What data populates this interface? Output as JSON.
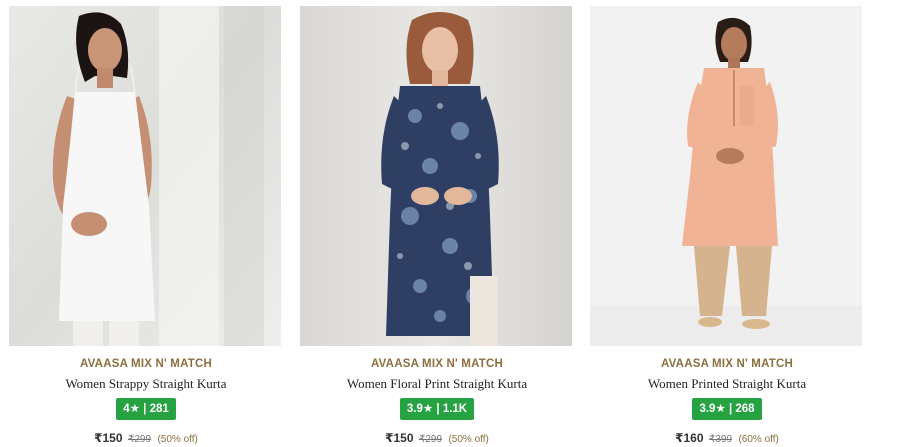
{
  "products": [
    {
      "brand": "AVAASA MIX N' MATCH",
      "name": "Women Strappy Straight Kurta",
      "rating": "4",
      "rating_count": "281",
      "star": "★",
      "sep": "|",
      "price": "₹150",
      "mrp": "₹299",
      "discount": "(50% off)"
    },
    {
      "brand": "AVAASA MIX N' MATCH",
      "name": "Women Floral Print Straight Kurta",
      "rating": "3.9",
      "rating_count": "1.1K",
      "star": "★",
      "sep": "|",
      "price": "₹150",
      "mrp": "₹299",
      "discount": "(50% off)"
    },
    {
      "brand": "AVAASA MIX N' MATCH",
      "name": "Women Printed Straight Kurta",
      "rating": "3.9",
      "rating_count": "268",
      "star": "★",
      "sep": "|",
      "price": "₹160",
      "mrp": "₹399",
      "discount": "(60% off)"
    }
  ],
  "colors": {
    "brand_text": "#8b6f3e",
    "rating_badge": "#27a243",
    "kurta_white": "#f7f7f7",
    "kurta_navy": "#2f3f63",
    "kurta_peach": "#f1b396"
  }
}
